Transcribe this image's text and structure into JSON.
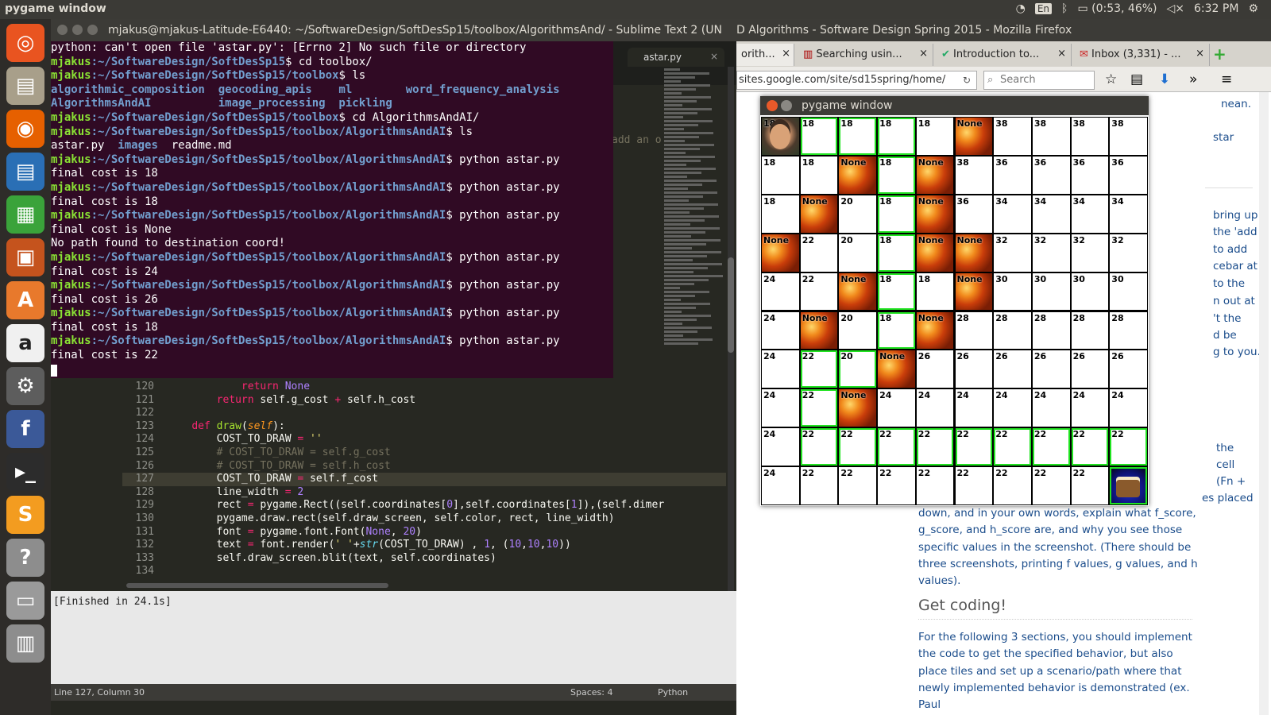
{
  "topbar": {
    "title": "pygame window",
    "kbd": "En",
    "battery": "(0:53, 46%)",
    "clock": "6:32 PM"
  },
  "launcher": [
    "ubuntu-logo-icon",
    "files-icon",
    "firefox-icon",
    "writer-icon",
    "calc-icon",
    "impress-icon",
    "software-center-icon",
    "amazon-icon",
    "settings-icon",
    "facebook-icon",
    "terminal-icon",
    "sublime-icon",
    "help-icon",
    "disk-icon",
    "trash-icon"
  ],
  "sublime": {
    "title": "mjakus@mjakus-Latitude-E6440: ~/SoftwareDesign/SoftDesSp15/toolbox/AlgorithmsAnd/ - Sublime Text 2 (UN",
    "tab_label": "astar.py",
    "stray_text": "add an o",
    "console_text": "[Finished in 24.1s]",
    "status": {
      "position": "Line 127, Column 30",
      "spaces": "Spaces: 4",
      "syntax": "Python"
    },
    "code": [
      {
        "n": "120",
        "t": "            return None"
      },
      {
        "n": "121",
        "t": "        return self.g_cost + self.h_cost"
      },
      {
        "n": "122",
        "t": ""
      },
      {
        "n": "123",
        "t": "    def draw(self):"
      },
      {
        "n": "124",
        "t": "        COST_TO_DRAW = ''"
      },
      {
        "n": "125",
        "t": "        # COST_TO_DRAW = self.g_cost"
      },
      {
        "n": "126",
        "t": "        # COST_TO_DRAW = self.h_cost"
      },
      {
        "n": "127",
        "t": "        COST_TO_DRAW = self.f_cost"
      },
      {
        "n": "128",
        "t": "        line_width = 2"
      },
      {
        "n": "129",
        "t": "        rect = pygame.Rect((self.coordinates[0],self.coordinates[1]),(self.dimer"
      },
      {
        "n": "130",
        "t": "        pygame.draw.rect(self.draw_screen, self.color, rect, line_width)"
      },
      {
        "n": "131",
        "t": "        font = pygame.font.Font(None, 20)"
      },
      {
        "n": "132",
        "t": "        text = font.render(' '+str(COST_TO_DRAW) , 1, (10,10,10))"
      },
      {
        "n": "133",
        "t": "        self.draw_screen.blit(text, self.coordinates)"
      },
      {
        "n": "134",
        "t": ""
      }
    ]
  },
  "terminal": {
    "lines": [
      {
        "type": "out",
        "text": "python: can't open file 'astar.py': [Errno 2] No such file or directory"
      },
      {
        "type": "prompt",
        "user": "mjakus",
        "path": ":~/SoftwareDesign/SoftDesSp15",
        "cmd": "$ cd toolbox/"
      },
      {
        "type": "prompt",
        "user": "mjakus",
        "path": ":~/SoftwareDesign/SoftDesSp15/toolbox",
        "cmd": "$ ls"
      },
      {
        "type": "dir",
        "text": "algorithmic_composition  geocoding_apis    ml        word_frequency_analysis"
      },
      {
        "type": "dir",
        "text": "AlgorithmsAndAI          image_processing  pickling"
      },
      {
        "type": "prompt",
        "user": "mjakus",
        "path": ":~/SoftwareDesign/SoftDesSp15/toolbox",
        "cmd": "$ cd AlgorithmsAndAI/"
      },
      {
        "type": "prompt",
        "user": "mjakus",
        "path": ":~/SoftwareDesign/SoftDesSp15/toolbox/AlgorithmsAndAI",
        "cmd": "$ ls"
      },
      {
        "type": "mixed",
        "a": "astar.py  ",
        "b": "images",
        "c": "  readme.md"
      },
      {
        "type": "prompt",
        "user": "mjakus",
        "path": ":~/SoftwareDesign/SoftDesSp15/toolbox/AlgorithmsAndAI",
        "cmd": "$ python astar.py"
      },
      {
        "type": "out",
        "text": "final cost is 18"
      },
      {
        "type": "prompt",
        "user": "mjakus",
        "path": ":~/SoftwareDesign/SoftDesSp15/toolbox/AlgorithmsAndAI",
        "cmd": "$ python astar.py"
      },
      {
        "type": "out",
        "text": "final cost is 18"
      },
      {
        "type": "prompt",
        "user": "mjakus",
        "path": ":~/SoftwareDesign/SoftDesSp15/toolbox/AlgorithmsAndAI",
        "cmd": "$ python astar.py"
      },
      {
        "type": "out",
        "text": "final cost is None"
      },
      {
        "type": "out",
        "text": "No path found to destination coord!"
      },
      {
        "type": "prompt",
        "user": "mjakus",
        "path": ":~/SoftwareDesign/SoftDesSp15/toolbox/AlgorithmsAndAI",
        "cmd": "$ python astar.py"
      },
      {
        "type": "out",
        "text": "final cost is 24"
      },
      {
        "type": "prompt",
        "user": "mjakus",
        "path": ":~/SoftwareDesign/SoftDesSp15/toolbox/AlgorithmsAndAI",
        "cmd": "$ python astar.py"
      },
      {
        "type": "out",
        "text": "final cost is 26"
      },
      {
        "type": "prompt",
        "user": "mjakus",
        "path": ":~/SoftwareDesign/SoftDesSp15/toolbox/AlgorithmsAndAI",
        "cmd": "$ python astar.py"
      },
      {
        "type": "out",
        "text": "final cost is 18"
      },
      {
        "type": "prompt",
        "user": "mjakus",
        "path": ":~/SoftwareDesign/SoftDesSp15/toolbox/AlgorithmsAndAI",
        "cmd": "$ python astar.py"
      },
      {
        "type": "out",
        "text": "final cost is 22"
      }
    ]
  },
  "firefox": {
    "title": "D Algorithms - Software Design Spring 2015 - Mozilla Firefox",
    "tabs": [
      "orith...",
      "Searching usin...",
      "Introduction to...",
      "Inbox (3,331) - ..."
    ],
    "url": "sites.google.com/site/sd15spring/home/",
    "search_placeholder": "Search",
    "snippets": [
      "nean.",
      "star",
      "bring up",
      "the 'add",
      "to add",
      "cebar at",
      "to the",
      "n out at",
      "'t the",
      "d be",
      "g to you."
    ],
    "snippets2": [
      "the",
      "cell",
      "(Fn +",
      "es placed"
    ],
    "para1": "down, and in your own words, explain what f_score, g_score, and h_score are, and why you see those specific values in the screenshot. (There should be three screenshots, printing f values, g values, and h values).",
    "heading": "Get coding!",
    "para2": "For the following 3 sections, you should implement the code to get the specified behavior, but also place tiles and set up a scenario/path where that newly implemented behavior is demonstrated (ex. Paul"
  },
  "pygame": {
    "title": "pygame window",
    "grid": [
      [
        {
          "v": "18",
          "k": "start",
          "g": false
        },
        {
          "v": "18",
          "k": "",
          "g": true
        },
        {
          "v": "18",
          "k": "",
          "g": true
        },
        {
          "v": "18",
          "k": "",
          "g": true
        },
        {
          "v": "18",
          "k": "",
          "g": false
        },
        {
          "v": "None",
          "k": "lava",
          "g": false
        },
        {
          "v": "38",
          "k": "",
          "g": false
        },
        {
          "v": "38",
          "k": "",
          "g": false
        },
        {
          "v": "38",
          "k": "",
          "g": false
        },
        {
          "v": "38",
          "k": "",
          "g": false
        }
      ],
      [
        {
          "v": "18",
          "k": "",
          "g": false
        },
        {
          "v": "18",
          "k": "",
          "g": false
        },
        {
          "v": "None",
          "k": "lava",
          "g": false
        },
        {
          "v": "18",
          "k": "",
          "g": true
        },
        {
          "v": "None",
          "k": "lava",
          "g": false
        },
        {
          "v": "38",
          "k": "",
          "g": false
        },
        {
          "v": "36",
          "k": "",
          "g": false
        },
        {
          "v": "36",
          "k": "",
          "g": false
        },
        {
          "v": "36",
          "k": "",
          "g": false
        },
        {
          "v": "36",
          "k": "",
          "g": false
        }
      ],
      [
        {
          "v": "18",
          "k": "",
          "g": false
        },
        {
          "v": "None",
          "k": "lava",
          "g": false
        },
        {
          "v": "20",
          "k": "",
          "g": false
        },
        {
          "v": "18",
          "k": "",
          "g": true
        },
        {
          "v": "None",
          "k": "lava",
          "g": false
        },
        {
          "v": "36",
          "k": "",
          "g": false
        },
        {
          "v": "34",
          "k": "",
          "g": false
        },
        {
          "v": "34",
          "k": "",
          "g": false
        },
        {
          "v": "34",
          "k": "",
          "g": false
        },
        {
          "v": "34",
          "k": "",
          "g": false
        }
      ],
      [
        {
          "v": "None",
          "k": "lava",
          "g": false
        },
        {
          "v": "22",
          "k": "",
          "g": false
        },
        {
          "v": "20",
          "k": "",
          "g": false
        },
        {
          "v": "18",
          "k": "",
          "g": true
        },
        {
          "v": "None",
          "k": "lava",
          "g": false
        },
        {
          "v": "None",
          "k": "lava",
          "g": false
        },
        {
          "v": "32",
          "k": "",
          "g": false
        },
        {
          "v": "32",
          "k": "",
          "g": false
        },
        {
          "v": "32",
          "k": "",
          "g": false
        },
        {
          "v": "32",
          "k": "",
          "g": false
        }
      ],
      [
        {
          "v": "24",
          "k": "",
          "g": false
        },
        {
          "v": "22",
          "k": "",
          "g": false
        },
        {
          "v": "None",
          "k": "lava",
          "g": false
        },
        {
          "v": "18",
          "k": "",
          "g": true
        },
        {
          "v": "18",
          "k": "",
          "g": false
        },
        {
          "v": "None",
          "k": "lava",
          "g": false
        },
        {
          "v": "30",
          "k": "",
          "g": false
        },
        {
          "v": "30",
          "k": "",
          "g": false
        },
        {
          "v": "30",
          "k": "",
          "g": false
        },
        {
          "v": "30",
          "k": "",
          "g": false
        }
      ],
      [
        {
          "v": "24",
          "k": "",
          "g": false
        },
        {
          "v": "None",
          "k": "lava",
          "g": false
        },
        {
          "v": "20",
          "k": "",
          "g": false
        },
        {
          "v": "18",
          "k": "",
          "g": true
        },
        {
          "v": "None",
          "k": "lava",
          "g": false
        },
        {
          "v": "28",
          "k": "",
          "g": false
        },
        {
          "v": "28",
          "k": "",
          "g": false
        },
        {
          "v": "28",
          "k": "",
          "g": false
        },
        {
          "v": "28",
          "k": "",
          "g": false
        },
        {
          "v": "28",
          "k": "",
          "g": false
        }
      ],
      [
        {
          "v": "24",
          "k": "",
          "g": false
        },
        {
          "v": "22",
          "k": "",
          "g": true
        },
        {
          "v": "20",
          "k": "",
          "g": true
        },
        {
          "v": "None",
          "k": "lava",
          "g": false
        },
        {
          "v": "26",
          "k": "",
          "g": false
        },
        {
          "v": "26",
          "k": "",
          "g": false
        },
        {
          "v": "26",
          "k": "",
          "g": false
        },
        {
          "v": "26",
          "k": "",
          "g": false
        },
        {
          "v": "26",
          "k": "",
          "g": false
        },
        {
          "v": "26",
          "k": "",
          "g": false
        }
      ],
      [
        {
          "v": "24",
          "k": "",
          "g": false
        },
        {
          "v": "22",
          "k": "",
          "g": true
        },
        {
          "v": "None",
          "k": "lava",
          "g": false
        },
        {
          "v": "24",
          "k": "",
          "g": false
        },
        {
          "v": "24",
          "k": "",
          "g": false
        },
        {
          "v": "24",
          "k": "",
          "g": false
        },
        {
          "v": "24",
          "k": "",
          "g": false
        },
        {
          "v": "24",
          "k": "",
          "g": false
        },
        {
          "v": "24",
          "k": "",
          "g": false
        },
        {
          "v": "24",
          "k": "",
          "g": false
        }
      ],
      [
        {
          "v": "24",
          "k": "",
          "g": false
        },
        {
          "v": "22",
          "k": "",
          "g": true
        },
        {
          "v": "22",
          "k": "",
          "g": true
        },
        {
          "v": "22",
          "k": "",
          "g": true
        },
        {
          "v": "22",
          "k": "",
          "g": true
        },
        {
          "v": "22",
          "k": "",
          "g": true
        },
        {
          "v": "22",
          "k": "",
          "g": true
        },
        {
          "v": "22",
          "k": "",
          "g": true
        },
        {
          "v": "22",
          "k": "",
          "g": true
        },
        {
          "v": "22",
          "k": "",
          "g": true
        }
      ],
      [
        {
          "v": "24",
          "k": "",
          "g": false
        },
        {
          "v": "22",
          "k": "",
          "g": false
        },
        {
          "v": "22",
          "k": "",
          "g": false
        },
        {
          "v": "22",
          "k": "",
          "g": false
        },
        {
          "v": "22",
          "k": "",
          "g": false
        },
        {
          "v": "22",
          "k": "",
          "g": false
        },
        {
          "v": "22",
          "k": "",
          "g": false
        },
        {
          "v": "22",
          "k": "",
          "g": false
        },
        {
          "v": "22",
          "k": "",
          "g": false
        },
        {
          "v": "",
          "k": "cake",
          "g": true
        }
      ]
    ]
  }
}
